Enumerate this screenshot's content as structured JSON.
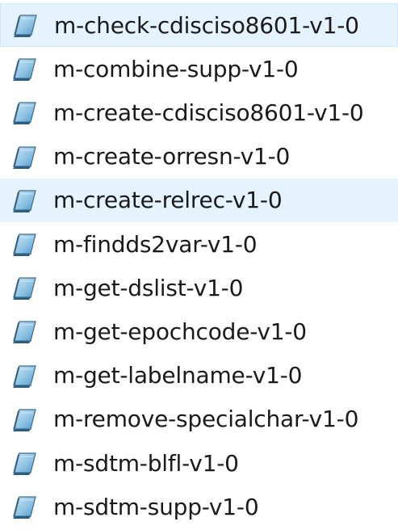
{
  "file_list": {
    "icon": "sas-program-file-icon",
    "items": [
      {
        "label": "m-check-cdisciso8601-v1-0",
        "state": "selected"
      },
      {
        "label": "m-combine-supp-v1-0",
        "state": "normal"
      },
      {
        "label": "m-create-cdisciso8601-v1-0",
        "state": "normal"
      },
      {
        "label": "m-create-orresn-v1-0",
        "state": "normal"
      },
      {
        "label": "m-create-relrec-v1-0",
        "state": "hover"
      },
      {
        "label": "m-findds2var-v1-0",
        "state": "normal"
      },
      {
        "label": "m-get-dslist-v1-0",
        "state": "normal"
      },
      {
        "label": "m-get-epochcode-v1-0",
        "state": "normal"
      },
      {
        "label": "m-get-labelname-v1-0",
        "state": "normal"
      },
      {
        "label": "m-remove-specialchar-v1-0",
        "state": "normal"
      },
      {
        "label": "m-sdtm-blfl-v1-0",
        "state": "normal"
      },
      {
        "label": "m-sdtm-supp-v1-0",
        "state": "normal"
      }
    ]
  },
  "colors": {
    "selected_background": "#e5f3ff",
    "selected_border": "#cce8ff",
    "hover_background": "#e5f3ff",
    "text": "#1a1a1a"
  }
}
